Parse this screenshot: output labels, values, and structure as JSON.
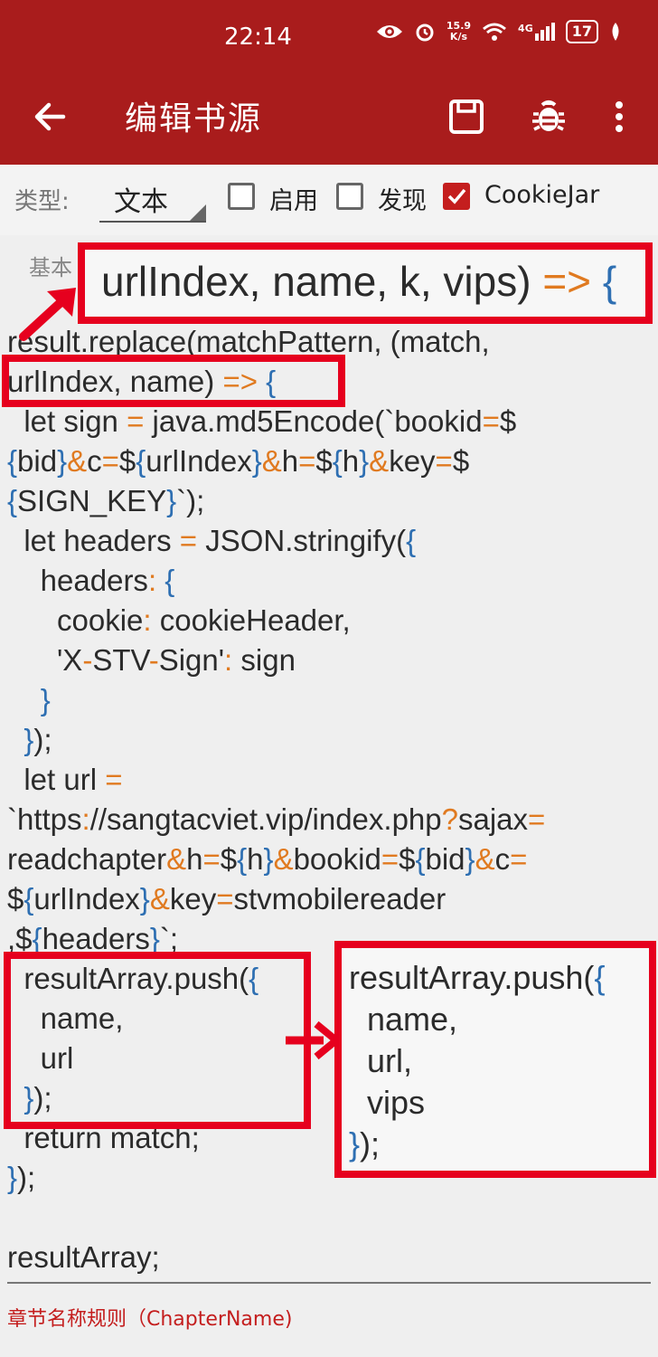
{
  "status_bar": {
    "time": "22:14",
    "net_speed_value": "15.9",
    "net_speed_unit": "K/s",
    "network": "4G",
    "battery": "17"
  },
  "app_bar": {
    "title": "编辑书源"
  },
  "options": {
    "type_label": "类型:",
    "type_value": "文本",
    "enable_label": "启用",
    "discover_label": "发现",
    "cookiejar_label": "CookieJar",
    "enable_checked": false,
    "discover_checked": false,
    "cookiejar_checked": true
  },
  "tab": {
    "basic_label": "基本"
  },
  "code_lines": [
    "result.replace(matchPattern, (match,",
    "urlIndex, name) => {",
    "  let sign = java.md5Encode(`bookid=$",
    "{bid}&c=${urlIndex}&h=${h}&key=$",
    "{SIGN_KEY}`);",
    "  let headers = JSON.stringify({",
    "    headers: {",
    "      cookie: cookieHeader,",
    "      'X-STV-Sign': sign",
    "    }",
    "  });",
    "  let url =",
    "`https://sangtacviet.vip/index.php?sajax=",
    "readchapter&h=${h}&bookid=${bid}&c=",
    "${urlIndex}&key=stvmobilereader",
    ",${headers}`;",
    "  resultArray.push({",
    "    name,",
    "    url",
    "  });",
    "  return match;",
    "});",
    "",
    "resultArray;"
  ],
  "field_label": "章节名称规则（ChapterName)",
  "annotations": {
    "zoom_top": "urlIndex, name, k, vips) => {",
    "zoom_bottom": "resultArray.push({\n  name,\n  url,\n  vips\n});"
  },
  "colors": {
    "app_bar": "#a91c1c",
    "accent": "#c41e1e",
    "annotation": "#e6001e",
    "operator": "#e07a20",
    "bracket": "#2e6fb2"
  },
  "icons": [
    "eye-icon",
    "alarm-icon",
    "wifi-icon",
    "signal-icon",
    "battery-icon",
    "leaf-icon",
    "back-arrow-icon",
    "save-icon",
    "bug-icon",
    "more-vert-icon",
    "arrow-up-right-icon",
    "arrow-right-icon"
  ]
}
